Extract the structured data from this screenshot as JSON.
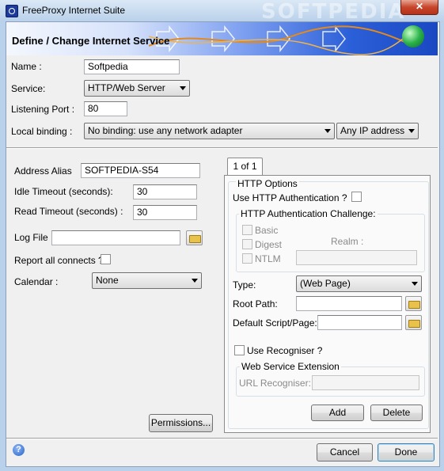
{
  "window": {
    "title": "FreeProxy Internet Suite",
    "watermark": "SOFTPEDIA",
    "close_label": "✕"
  },
  "banner": {
    "title": "Define / Change Internet Service"
  },
  "form": {
    "name_label": "Name :",
    "name_value": "Softpedia",
    "service_label": "Service:",
    "service_value": "HTTP/Web Server",
    "port_label": "Listening Port :",
    "port_value": "80",
    "binding_label": "Local binding :",
    "binding_value": "No binding: use any network adapter",
    "ip_value": "Any IP address"
  },
  "left": {
    "alias_label": "Address Alias",
    "alias_value": "SOFTPEDIA-S54",
    "idle_label": "Idle Timeout (seconds):",
    "idle_value": "30",
    "read_label": "Read Timeout (seconds) :",
    "read_value": "30",
    "log_label": "Log File :",
    "log_value": "",
    "report_label": "Report all connects ?",
    "calendar_label": "Calendar :",
    "calendar_value": "None",
    "permissions_label": "Permissions..."
  },
  "tab": {
    "label": "1 of 1"
  },
  "http": {
    "group_title": "HTTP Options",
    "auth_label": "Use HTTP Authentication  ?",
    "challenge_title": "HTTP Authentication Challenge:",
    "basic_label": "Basic",
    "digest_label": "Digest",
    "ntlm_label": "NTLM",
    "realm_label": "Realm :",
    "realm_value": "",
    "type_label": "Type:",
    "type_value": "(Web Page)",
    "root_label": "Root Path:",
    "root_value": "",
    "script_label": "Default Script/Page:",
    "script_value": "",
    "recogniser_label": "Use Recogniser ?",
    "wse_title": "Web Service Extension",
    "url_label": "URL Recogniser:",
    "url_value": "",
    "add_label": "Add",
    "delete_label": "Delete"
  },
  "footer": {
    "cancel_label": "Cancel",
    "done_label": "Done",
    "help_icon": "?"
  },
  "colors": {
    "banner_blue": "#1a48c2",
    "title_bar": "#b9d1ea"
  }
}
